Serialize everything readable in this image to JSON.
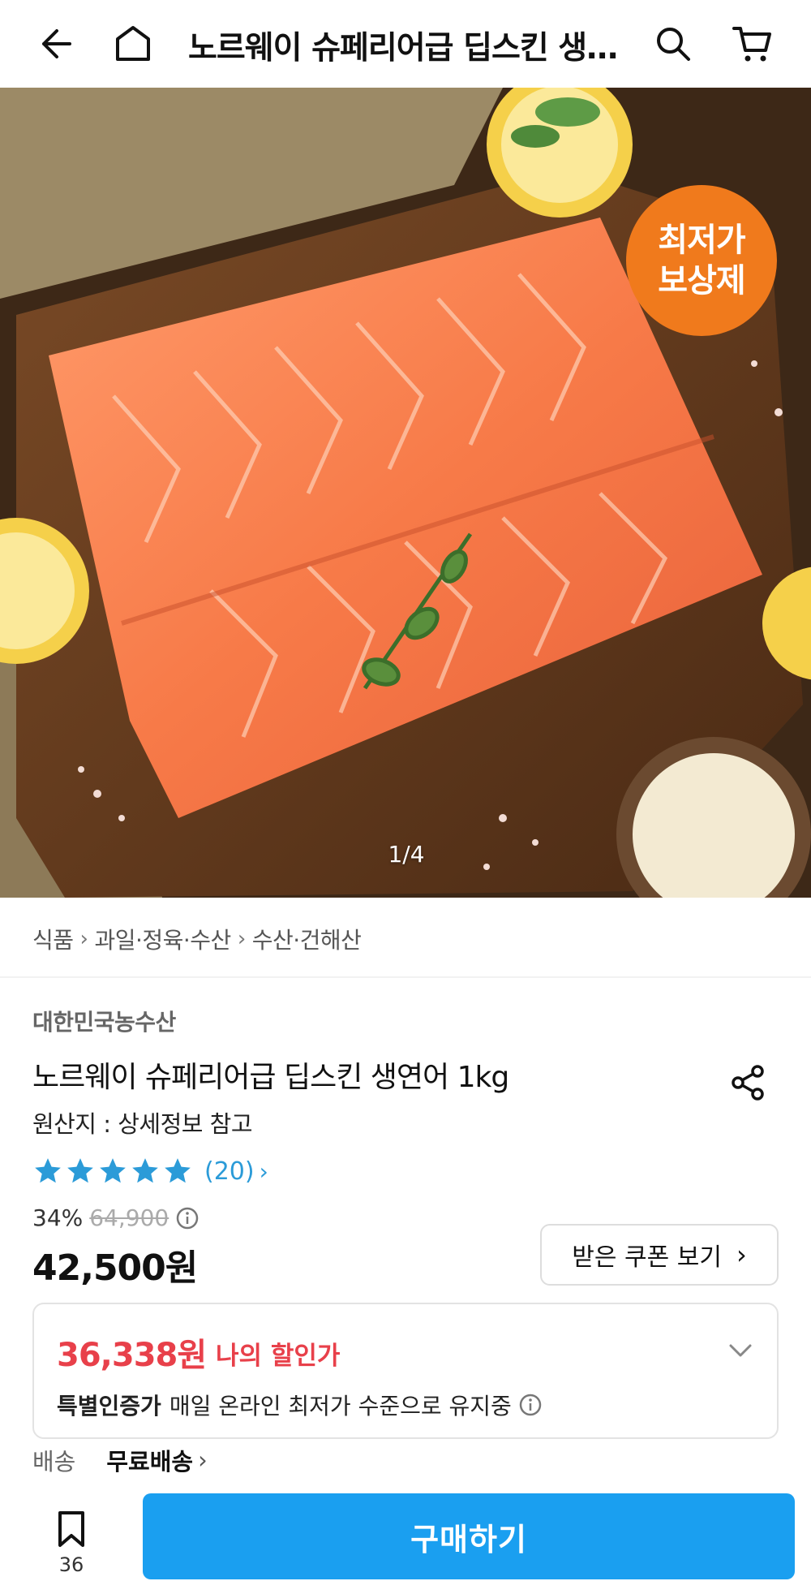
{
  "header": {
    "title": "노르웨이 슈페리어급 딥스킨 생…",
    "icons": [
      "back-arrow-icon",
      "home-icon",
      "search-icon",
      "cart-icon"
    ]
  },
  "hero": {
    "badge_line1": "최저가",
    "badge_line2": "보상제",
    "page_indicator": "1/4",
    "badge_color": "#f07a1c"
  },
  "breadcrumb": [
    "식품",
    "과일·정육·수산",
    "수산·건해산"
  ],
  "product": {
    "brand": "대한민국농수산",
    "title": "노르웨이 슈페리어급 딥스킨 생연어 1kg",
    "origin": "원산지 : 상세정보 참고",
    "rating_stars": 5,
    "review_count": "(20)",
    "discount_percent": "34%",
    "original_price": "64,900",
    "sale_price": "42,500원",
    "coupon_button": "받은 쿠폰 보기"
  },
  "my_discount": {
    "price": "36,338원",
    "label": "나의 할인가",
    "note_bold": "특별인증가",
    "note_text": "매일 온라인 최저가 수준으로 유지중",
    "accent_color": "#e8404a"
  },
  "shipping": {
    "label": "배송",
    "value": "무료배송"
  },
  "bottom_bar": {
    "wish_count": "36",
    "buy_label": "구매하기",
    "buy_color": "#1a9ff0"
  }
}
